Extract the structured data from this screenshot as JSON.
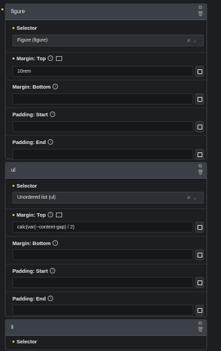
{
  "blocks": [
    {
      "title": "figure",
      "selector_label": "Selector",
      "selector_value": "Figure (figure)",
      "fields": [
        {
          "label": "Margin: Top",
          "value": "10rem"
        },
        {
          "label": "Margin: Bottom",
          "value": ""
        },
        {
          "label": "Padding: Start",
          "value": ""
        },
        {
          "label": "Padding: End",
          "value": ""
        }
      ]
    },
    {
      "title": "ul",
      "selector_label": "Selector",
      "selector_value": "Unordered list (ul)",
      "fields": [
        {
          "label": "Margin: Top",
          "value": "calc(var(--content-gap) / 2)"
        },
        {
          "label": "Margin: Bottom",
          "value": ""
        },
        {
          "label": "Padding: Start",
          "value": ""
        },
        {
          "label": "Padding: End",
          "value": ""
        }
      ]
    },
    {
      "title": "li",
      "selector_label": "Selector"
    }
  ],
  "icons": {
    "info": "info-circle-icon",
    "responsive": "monitor-icon",
    "unit": "unit-toggle-icon",
    "clear": "clear-x-icon",
    "dropdown": "chevron-down-icon",
    "move": "move-icon",
    "delete": "trash-icon"
  }
}
